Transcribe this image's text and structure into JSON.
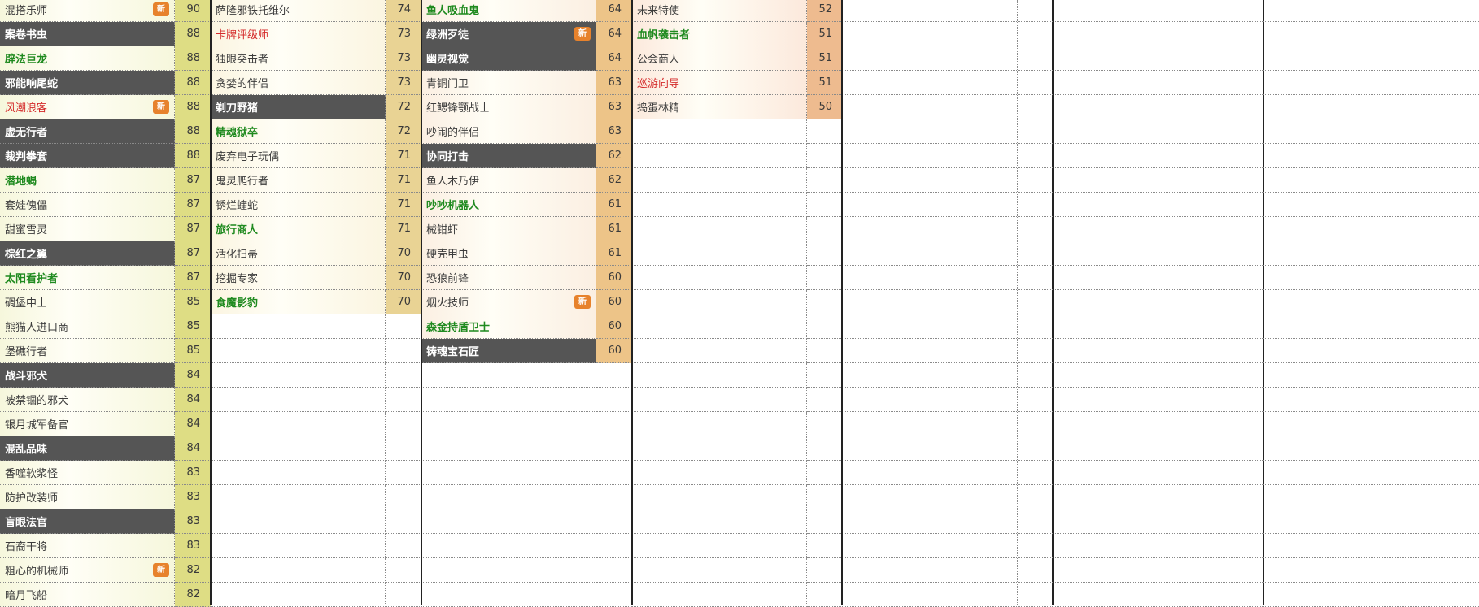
{
  "colors": {
    "dark_row": "#555555",
    "new_badge": "#e7822c",
    "green_text": "#1f8a1f",
    "red_text": "#d42b2b",
    "tier_colors": [
      "#f6f7dc",
      "#fbf5e1",
      "#fbefe2",
      "#fce9dc"
    ],
    "score_colors": [
      "#dedd84",
      "#e9d394",
      "#edc488",
      "#eebb8f"
    ]
  },
  "columns": [
    {
      "rows": [
        {
          "name": "混搭乐师",
          "score": "90",
          "style": "default",
          "new": true
        },
        {
          "name": "案卷书虫",
          "score": "88",
          "style": "dark"
        },
        {
          "name": "辟法巨龙",
          "score": "88",
          "style": "green"
        },
        {
          "name": "邪能响尾蛇",
          "score": "88",
          "style": "dark"
        },
        {
          "name": "风潮浪客",
          "score": "88",
          "style": "red",
          "new": true
        },
        {
          "name": "虚无行者",
          "score": "88",
          "style": "dark"
        },
        {
          "name": "裁判拳套",
          "score": "88",
          "style": "dark"
        },
        {
          "name": "潜地蝎",
          "score": "87",
          "style": "green"
        },
        {
          "name": "套娃傀儡",
          "score": "87",
          "style": "default"
        },
        {
          "name": "甜蜜雪灵",
          "score": "87",
          "style": "default"
        },
        {
          "name": "棕红之翼",
          "score": "87",
          "style": "dark"
        },
        {
          "name": "太阳看护者",
          "score": "87",
          "style": "green"
        },
        {
          "name": "碉堡中士",
          "score": "85",
          "style": "default"
        },
        {
          "name": "熊猫人进口商",
          "score": "85",
          "style": "default"
        },
        {
          "name": "堡礁行者",
          "score": "85",
          "style": "default"
        },
        {
          "name": "战斗邪犬",
          "score": "84",
          "style": "dark"
        },
        {
          "name": "被禁锢的邪犬",
          "score": "84",
          "style": "default"
        },
        {
          "name": "银月城军备官",
          "score": "84",
          "style": "default"
        },
        {
          "name": "混乱品味",
          "score": "84",
          "style": "dark"
        },
        {
          "name": "香噬软浆怪",
          "score": "83",
          "style": "default"
        },
        {
          "name": "防护改装师",
          "score": "83",
          "style": "default"
        },
        {
          "name": "盲眼法官",
          "score": "83",
          "style": "dark"
        },
        {
          "name": "石裔干将",
          "score": "83",
          "style": "default"
        },
        {
          "name": "粗心的机械师",
          "score": "82",
          "style": "default",
          "new": true
        },
        {
          "name": "暗月飞船",
          "score": "82",
          "style": "default"
        }
      ]
    },
    {
      "rows": [
        {
          "name": "萨隆邪铁托维尔",
          "score": "74",
          "style": "default"
        },
        {
          "name": "卡牌评级师",
          "score": "73",
          "style": "red"
        },
        {
          "name": "独眼突击者",
          "score": "73",
          "style": "default"
        },
        {
          "name": "贪婪的伴侣",
          "score": "73",
          "style": "default"
        },
        {
          "name": "剃刀野猪",
          "score": "72",
          "style": "dark"
        },
        {
          "name": "精魂狱卒",
          "score": "72",
          "style": "green"
        },
        {
          "name": "废弃电子玩偶",
          "score": "71",
          "style": "default"
        },
        {
          "name": "鬼灵爬行者",
          "score": "71",
          "style": "default"
        },
        {
          "name": "锈烂蝰蛇",
          "score": "71",
          "style": "default"
        },
        {
          "name": "旅行商人",
          "score": "71",
          "style": "green"
        },
        {
          "name": "活化扫帚",
          "score": "70",
          "style": "default"
        },
        {
          "name": "挖掘专家",
          "score": "70",
          "style": "default"
        },
        {
          "name": "食魔影豹",
          "score": "70",
          "style": "green"
        }
      ]
    },
    {
      "rows": [
        {
          "name": "鱼人吸血鬼",
          "score": "64",
          "style": "green"
        },
        {
          "name": "绿洲歹徒",
          "score": "64",
          "style": "dark",
          "new": true
        },
        {
          "name": "幽灵视觉",
          "score": "64",
          "style": "dark"
        },
        {
          "name": "青铜门卫",
          "score": "63",
          "style": "default"
        },
        {
          "name": "红鳃锋颚战士",
          "score": "63",
          "style": "default"
        },
        {
          "name": "吵闹的伴侣",
          "score": "63",
          "style": "default"
        },
        {
          "name": "协同打击",
          "score": "62",
          "style": "dark"
        },
        {
          "name": "鱼人木乃伊",
          "score": "62",
          "style": "default"
        },
        {
          "name": "吵吵机器人",
          "score": "61",
          "style": "green"
        },
        {
          "name": "械钳虾",
          "score": "61",
          "style": "default"
        },
        {
          "name": "硬壳甲虫",
          "score": "61",
          "style": "default"
        },
        {
          "name": "恐狼前锋",
          "score": "60",
          "style": "default"
        },
        {
          "name": "烟火技师",
          "score": "60",
          "style": "default",
          "new": true
        },
        {
          "name": "森金持盾卫士",
          "score": "60",
          "style": "green"
        },
        {
          "name": "铸魂宝石匠",
          "score": "60",
          "style": "dark"
        }
      ]
    },
    {
      "rows": [
        {
          "name": "未来特使",
          "score": "52",
          "style": "default"
        },
        {
          "name": "血帆袭击者",
          "score": "51",
          "style": "green"
        },
        {
          "name": "公会商人",
          "score": "51",
          "style": "default"
        },
        {
          "name": "巡游向导",
          "score": "51",
          "style": "red"
        },
        {
          "name": "捣蛋林精",
          "score": "50",
          "style": "default"
        }
      ]
    }
  ],
  "new_badge_label": "新"
}
